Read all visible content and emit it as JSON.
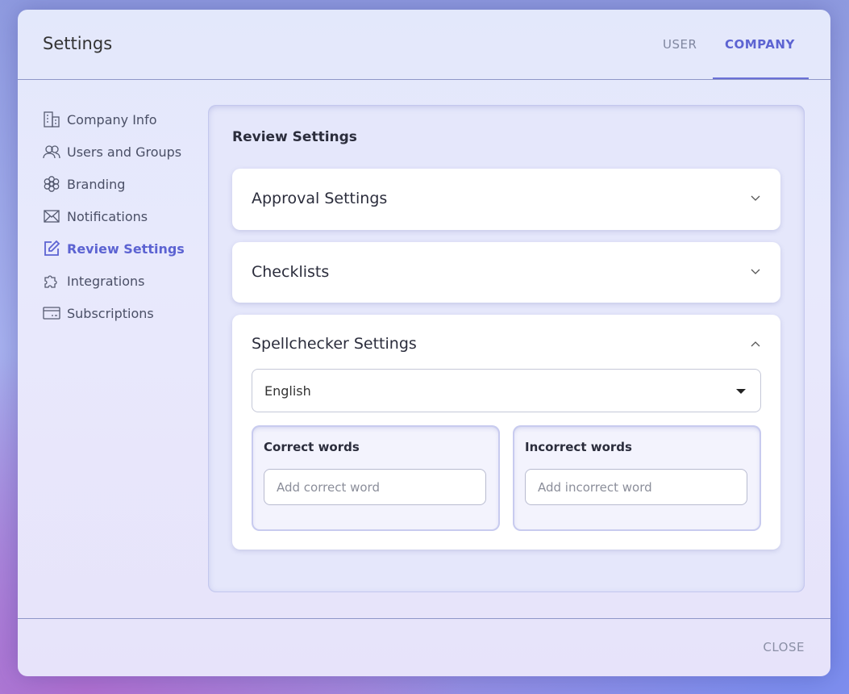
{
  "header": {
    "title": "Settings",
    "tabs": [
      {
        "label": "USER",
        "active": false
      },
      {
        "label": "COMPANY",
        "active": true
      }
    ]
  },
  "sidebar": {
    "items": [
      {
        "label": "Company Info",
        "icon": "building-icon",
        "active": false
      },
      {
        "label": "Users and Groups",
        "icon": "users-icon",
        "active": false
      },
      {
        "label": "Branding",
        "icon": "flower-icon",
        "active": false
      },
      {
        "label": "Notifications",
        "icon": "envelope-icon",
        "active": false
      },
      {
        "label": "Review Settings",
        "icon": "edit-icon",
        "active": true
      },
      {
        "label": "Integrations",
        "icon": "puzzle-icon",
        "active": false
      },
      {
        "label": "Subscriptions",
        "icon": "card-icon",
        "active": false
      }
    ]
  },
  "main": {
    "title": "Review Settings",
    "sections": [
      {
        "title": "Approval Settings",
        "expanded": false
      },
      {
        "title": "Checklists",
        "expanded": false
      },
      {
        "title": "Spellchecker Settings",
        "expanded": true
      }
    ],
    "spellchecker": {
      "language": "English",
      "correct": {
        "title": "Correct words",
        "placeholder": "Add correct word"
      },
      "incorrect": {
        "title": "Incorrect words",
        "placeholder": "Add incorrect word"
      }
    }
  },
  "footer": {
    "close_label": "CLOSE"
  },
  "colors": {
    "accent": "#5c63d2",
    "text": "#4a4f66",
    "muted": "#8b90a6"
  }
}
